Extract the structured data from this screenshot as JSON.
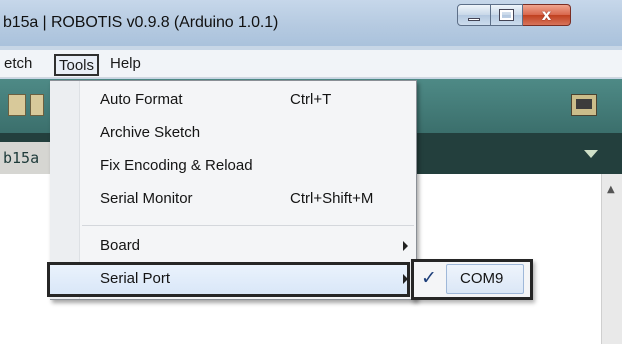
{
  "window": {
    "title": "b15a | ROBOTIS v0.9.8 (Arduino 1.0.1)"
  },
  "menubar": {
    "items": [
      {
        "label": "etch"
      },
      {
        "label": "Tools"
      },
      {
        "label": "Help"
      }
    ]
  },
  "tab": {
    "label": "b15a"
  },
  "tools_menu": {
    "items": [
      {
        "label": "Auto Format",
        "shortcut": "Ctrl+T"
      },
      {
        "label": "Archive Sketch",
        "shortcut": ""
      },
      {
        "label": "Fix Encoding & Reload",
        "shortcut": ""
      },
      {
        "label": "Serial Monitor",
        "shortcut": "Ctrl+Shift+M"
      },
      {
        "label": "Board",
        "shortcut": "",
        "has_submenu": true
      },
      {
        "label": "Serial Port",
        "shortcut": "",
        "has_submenu": true,
        "highlighted": true
      }
    ]
  },
  "serial_port_submenu": {
    "items": [
      {
        "label": "COM9",
        "checked": true,
        "check_glyph": "✓"
      }
    ]
  },
  "icons": {
    "minimize": "minimize-icon",
    "maximize": "maximize-icon",
    "close": "close-icon",
    "close_glyph": "x",
    "serial_monitor": "serial-monitor-icon",
    "tab_menu": "chevron-down-icon",
    "scroll_up": "scroll-up-arrow-icon",
    "scroll_up_glyph": "▲"
  },
  "colors": {
    "toolbar": "#3b6f6c",
    "tabstrip": "#233f3d",
    "menu_highlight_border": "#262626",
    "close_button": "#c0401f"
  }
}
